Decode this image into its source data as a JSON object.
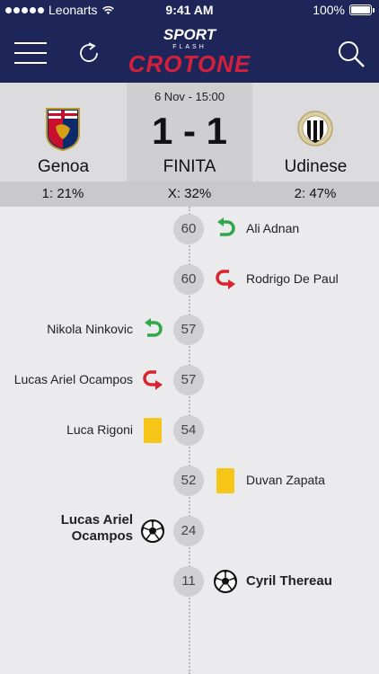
{
  "status_bar": {
    "carrier": "Leonarts",
    "time": "9:41 AM",
    "battery": "100%"
  },
  "header": {
    "logo_top": "SPORT",
    "logo_sub": "FLASH",
    "logo_main": "CROTONE"
  },
  "match": {
    "home_team": "Genoa",
    "away_team": "Udinese",
    "date": "6 Nov - 15:00",
    "score": "1 - 1",
    "status": "FINITA",
    "odds_home": "1: 21%",
    "odds_draw": "X: 32%",
    "odds_away": "2: 47%",
    "home_color_red": "#c8102e",
    "home_color_blue": "#0d2a6b"
  },
  "events": [
    {
      "minute": "60",
      "side": "right",
      "type": "substitution-in",
      "player": "Ali Adnan"
    },
    {
      "minute": "60",
      "side": "right",
      "type": "substitution-out",
      "player": "Rodrigo De Paul"
    },
    {
      "minute": "57",
      "side": "left",
      "type": "substitution-in",
      "player": "Nikola Ninkovic"
    },
    {
      "minute": "57",
      "side": "left",
      "type": "substitution-out",
      "player": "Lucas Ariel Ocampos"
    },
    {
      "minute": "54",
      "side": "left",
      "type": "yellow-card",
      "player": "Luca Rigoni"
    },
    {
      "minute": "52",
      "side": "right",
      "type": "yellow-card",
      "player": "Duvan Zapata"
    },
    {
      "minute": "24",
      "side": "left",
      "type": "goal",
      "player": "Lucas Ariel Ocampos"
    },
    {
      "minute": "11",
      "side": "right",
      "type": "goal",
      "player": "Cyril Thereau"
    }
  ]
}
